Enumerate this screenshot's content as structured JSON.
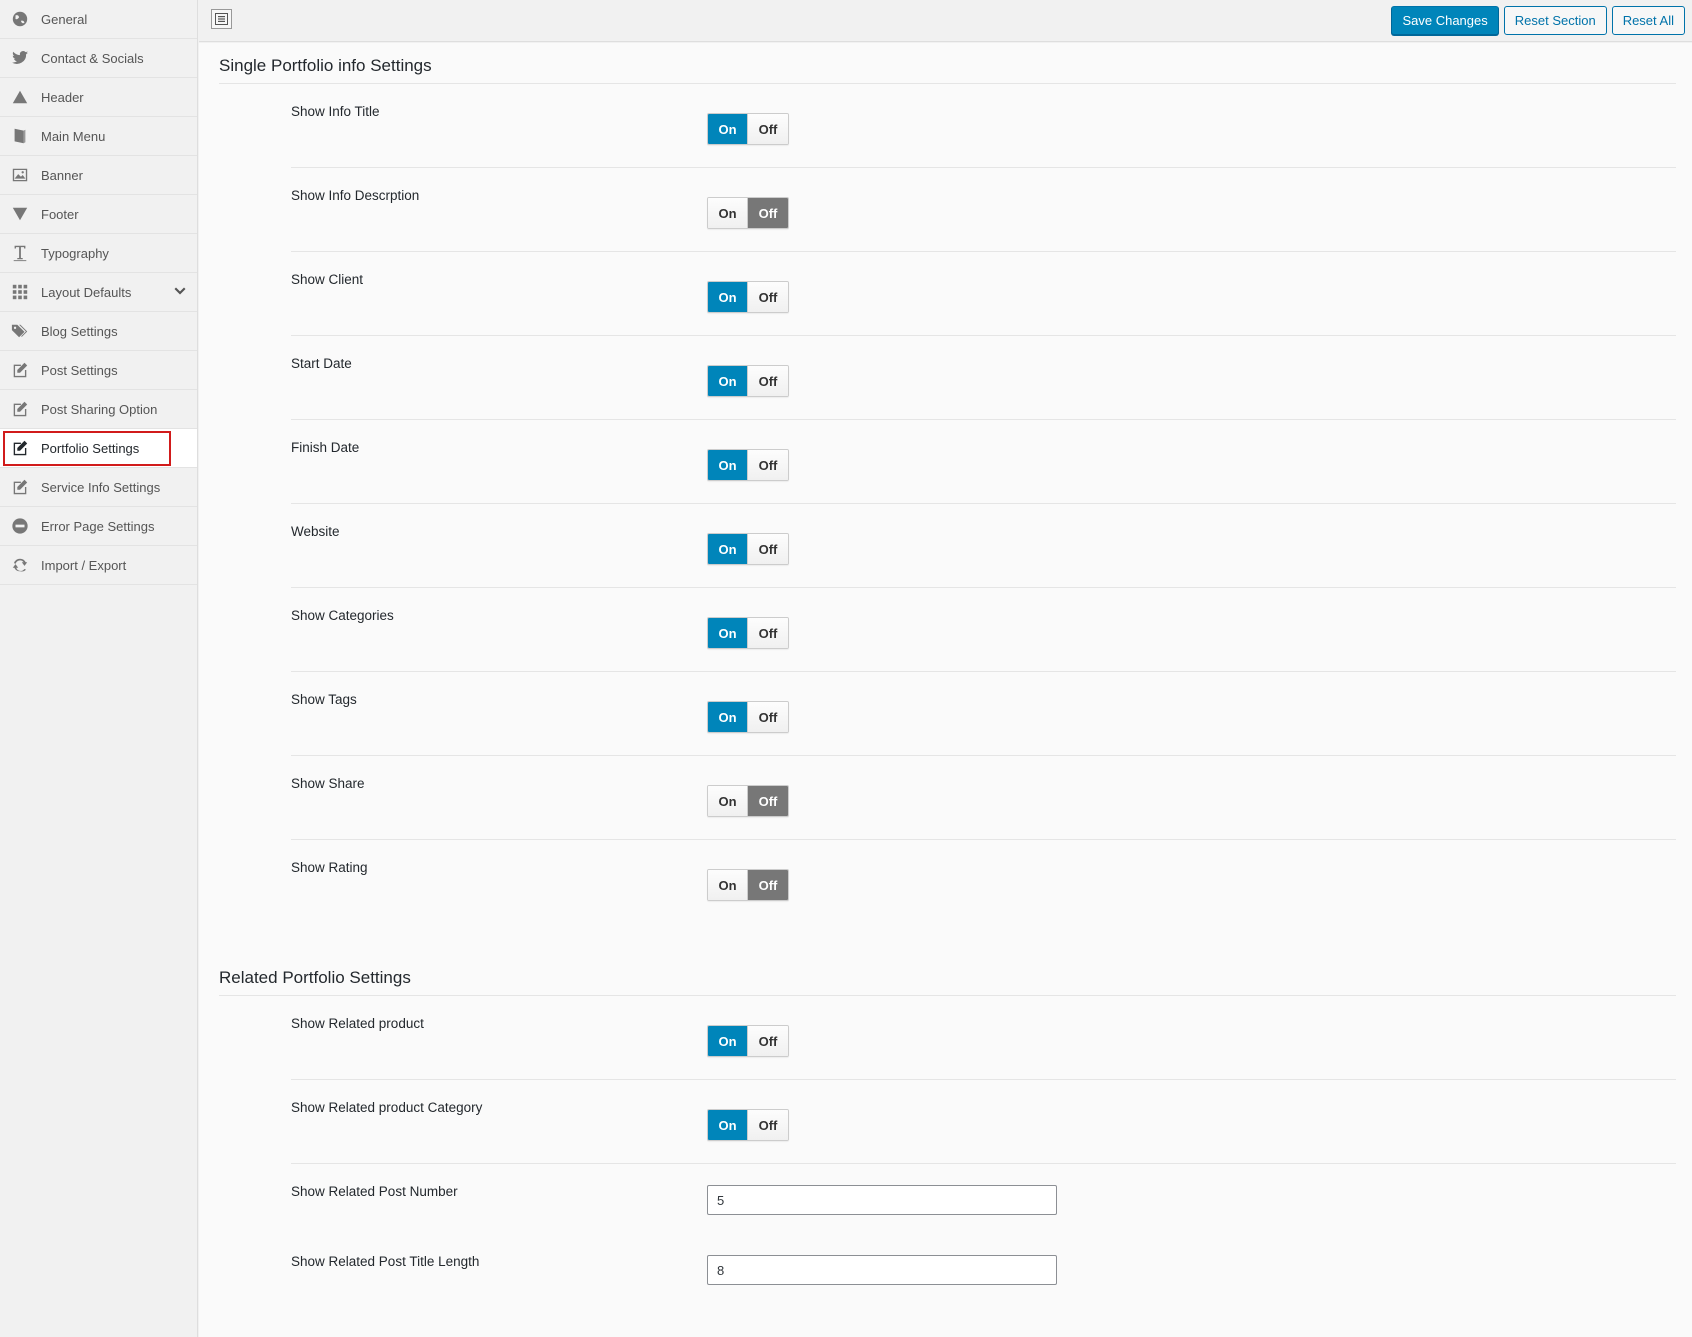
{
  "sidebar": {
    "items": [
      {
        "label": "General",
        "icon": "globe-icon"
      },
      {
        "label": "Contact & Socials",
        "icon": "twitter-icon"
      },
      {
        "label": "Header",
        "icon": "triangle-up-icon"
      },
      {
        "label": "Main Menu",
        "icon": "book-icon"
      },
      {
        "label": "Banner",
        "icon": "image-icon"
      },
      {
        "label": "Footer",
        "icon": "triangle-down-icon"
      },
      {
        "label": "Typography",
        "icon": "text-cursor-icon"
      },
      {
        "label": "Layout Defaults",
        "icon": "grid-icon"
      },
      {
        "label": "Blog Settings",
        "icon": "tags-icon"
      },
      {
        "label": "Post Settings",
        "icon": "edit-icon"
      },
      {
        "label": "Post Sharing Option",
        "icon": "edit-icon"
      },
      {
        "label": "Portfolio Settings",
        "icon": "edit-icon"
      },
      {
        "label": "Service Info Settings",
        "icon": "edit-icon"
      },
      {
        "label": "Error Page Settings",
        "icon": "minus-circle-icon"
      },
      {
        "label": "Import / Export",
        "icon": "refresh-icon"
      }
    ],
    "active": "Portfolio Settings"
  },
  "topbar": {
    "save_label": "Save Changes",
    "reset_section_label": "Reset Section",
    "reset_all_label": "Reset All"
  },
  "sections": {
    "single": {
      "title": "Single Portfolio info Settings",
      "rows": [
        {
          "label": "Show Info Title",
          "value": "On"
        },
        {
          "label": "Show Info Descrption",
          "value": "Off"
        },
        {
          "label": "Show Client",
          "value": "On"
        },
        {
          "label": "Start Date",
          "value": "On"
        },
        {
          "label": "Finish Date",
          "value": "On"
        },
        {
          "label": "Website",
          "value": "On"
        },
        {
          "label": "Show Categories",
          "value": "On"
        },
        {
          "label": "Show Tags",
          "value": "On"
        },
        {
          "label": "Show Share",
          "value": "Off"
        },
        {
          "label": "Show Rating",
          "value": "Off"
        }
      ]
    },
    "related": {
      "title": "Related Portfolio Settings",
      "rows": [
        {
          "label": "Show Related product",
          "value": "On"
        },
        {
          "label": "Show Related product Category",
          "value": "On"
        }
      ],
      "inputs": [
        {
          "label": "Show Related Post Number",
          "value": "5"
        },
        {
          "label": "Show Related Post Title Length",
          "value": "8"
        }
      ]
    }
  },
  "toggle": {
    "on_label": "On",
    "off_label": "Off"
  },
  "colors": {
    "accent": "#0085ba",
    "off_selected": "#777777",
    "active_outline": "#d11b1b"
  }
}
